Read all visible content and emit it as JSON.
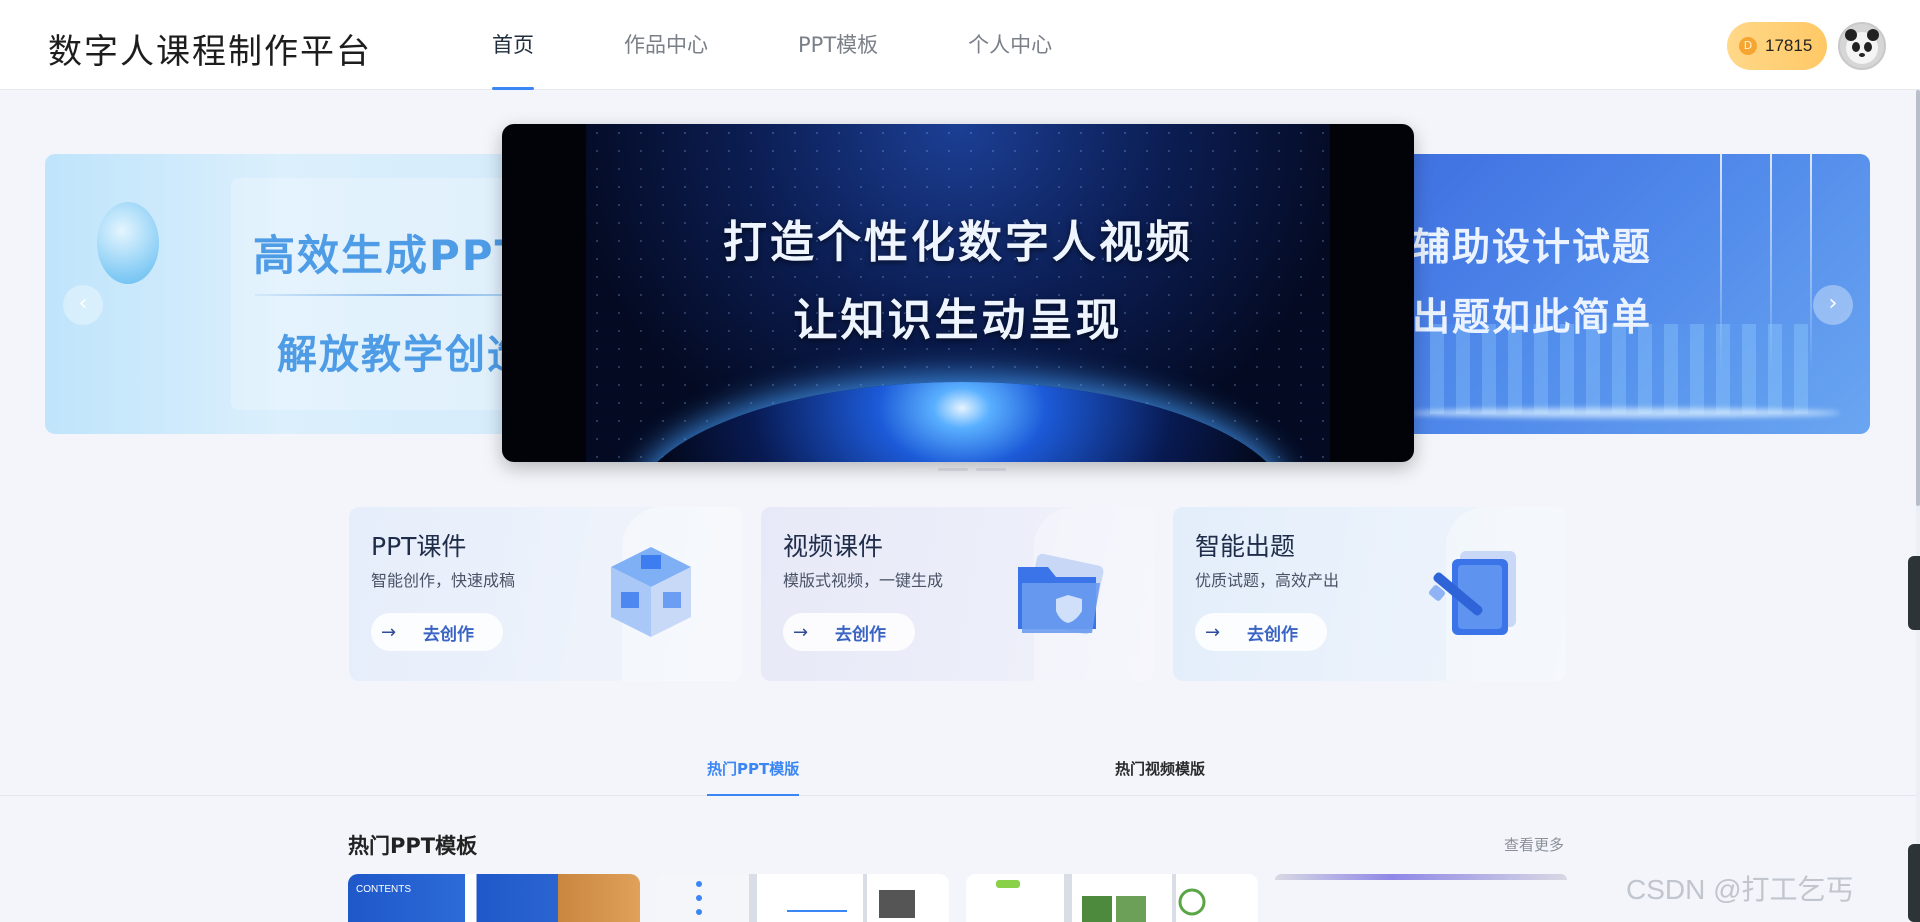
{
  "app": {
    "title": "数字人课程制作平台"
  },
  "nav": {
    "items": [
      {
        "label": "首页",
        "active": true
      },
      {
        "label": "作品中心",
        "active": false
      },
      {
        "label": "PPT模板",
        "active": false
      },
      {
        "label": "个人中心",
        "active": false
      }
    ]
  },
  "user": {
    "coins": "17815",
    "coin_icon": "coin-icon",
    "avatar_icon": "panda-avatar"
  },
  "carousel": {
    "left": {
      "line1": "高效生成PPT",
      "line2": "解放教学创造"
    },
    "center": {
      "line1": "打造个性化数字人视频",
      "line2": "让知识生动呈现"
    },
    "right": {
      "line1": "辅助设计试题",
      "line2": "出题如此简单"
    },
    "prev_icon": "‹",
    "next_icon": "›",
    "active_index": 0,
    "slide_count": 3
  },
  "cards": [
    {
      "title": "PPT课件",
      "subtitle": "智能创作，快速成稿",
      "button": "去创作",
      "icon": "cube-icon"
    },
    {
      "title": "视频课件",
      "subtitle": "模版式视频，一键生成",
      "button": "去创作",
      "icon": "folder-icon"
    },
    {
      "title": "智能出题",
      "subtitle": "优质试题，高效产出",
      "button": "去创作",
      "icon": "pen-paper-icon"
    }
  ],
  "tabs": [
    {
      "label": "热门PPT模版",
      "active": true
    },
    {
      "label": "热门视频模版",
      "active": false
    }
  ],
  "hot": {
    "title": "热门PPT模板",
    "more": "查看更多",
    "thumb1_text": "CONTENTS"
  },
  "colors": {
    "accent": "#3b86f5",
    "coin_bg": "#ffd37a"
  },
  "watermark": "CSDN @打工乞丐"
}
